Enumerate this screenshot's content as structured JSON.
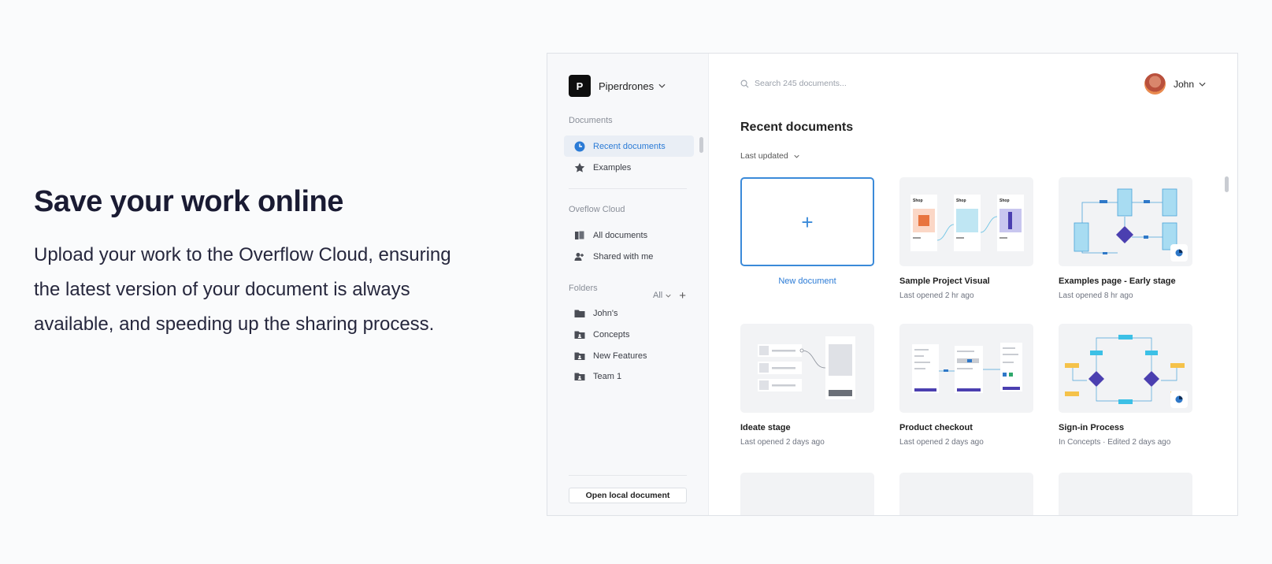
{
  "hero": {
    "title": "Save your work online",
    "body": "Upload your work to the Overflow Cloud, ensuring the latest version of your document is always available, and speeding up the sharing process."
  },
  "window": {
    "close_label": "×"
  },
  "sidebar": {
    "workspace": {
      "initial": "P",
      "name": "Piperdrones"
    },
    "documents_label": "Documents",
    "documents_items": [
      {
        "label": "Recent documents",
        "icon": "clock-icon",
        "active": true
      },
      {
        "label": "Examples",
        "icon": "star-icon",
        "active": false
      }
    ],
    "cloud_label": "Oveflow Cloud",
    "cloud_items": [
      {
        "label": "All documents",
        "icon": "documents-icon"
      },
      {
        "label": "Shared with me",
        "icon": "shared-user-icon"
      }
    ],
    "folders_label": "Folders",
    "folders_filter": "All",
    "folders": [
      {
        "label": "John's",
        "icon": "folder-icon"
      },
      {
        "label": "Concepts",
        "icon": "shared-folder-icon"
      },
      {
        "label": "New Features",
        "icon": "shared-folder-icon"
      },
      {
        "label": "Team 1",
        "icon": "shared-folder-icon"
      }
    ],
    "open_local_label": "Open local document"
  },
  "main": {
    "search_placeholder": "Search 245 documents...",
    "user_name": "John",
    "title": "Recent documents",
    "sort_label": "Last updated",
    "new_doc_label": "New document",
    "cards": [
      {
        "title": "Sample Project Visual",
        "sub": "Last opened 2 hr ago"
      },
      {
        "title": "Examples page - Early stage",
        "sub": "Last opened 8 hr ago"
      },
      {
        "title": "Ideate stage",
        "sub": "Last opened 2 days ago"
      },
      {
        "title": "Product checkout",
        "sub": "Last opened 2 days ago"
      },
      {
        "title": "Sign-in Process",
        "sub": "In Concepts  ·  Edited 2 days ago"
      }
    ],
    "thumb_labels": {
      "shop": "Shop"
    }
  },
  "colors": {
    "accent": "#2b7bd6",
    "flow_blue": "#9fd8f0",
    "flow_purple": "#4b3fb0",
    "flow_yellow": "#f5c24a"
  }
}
